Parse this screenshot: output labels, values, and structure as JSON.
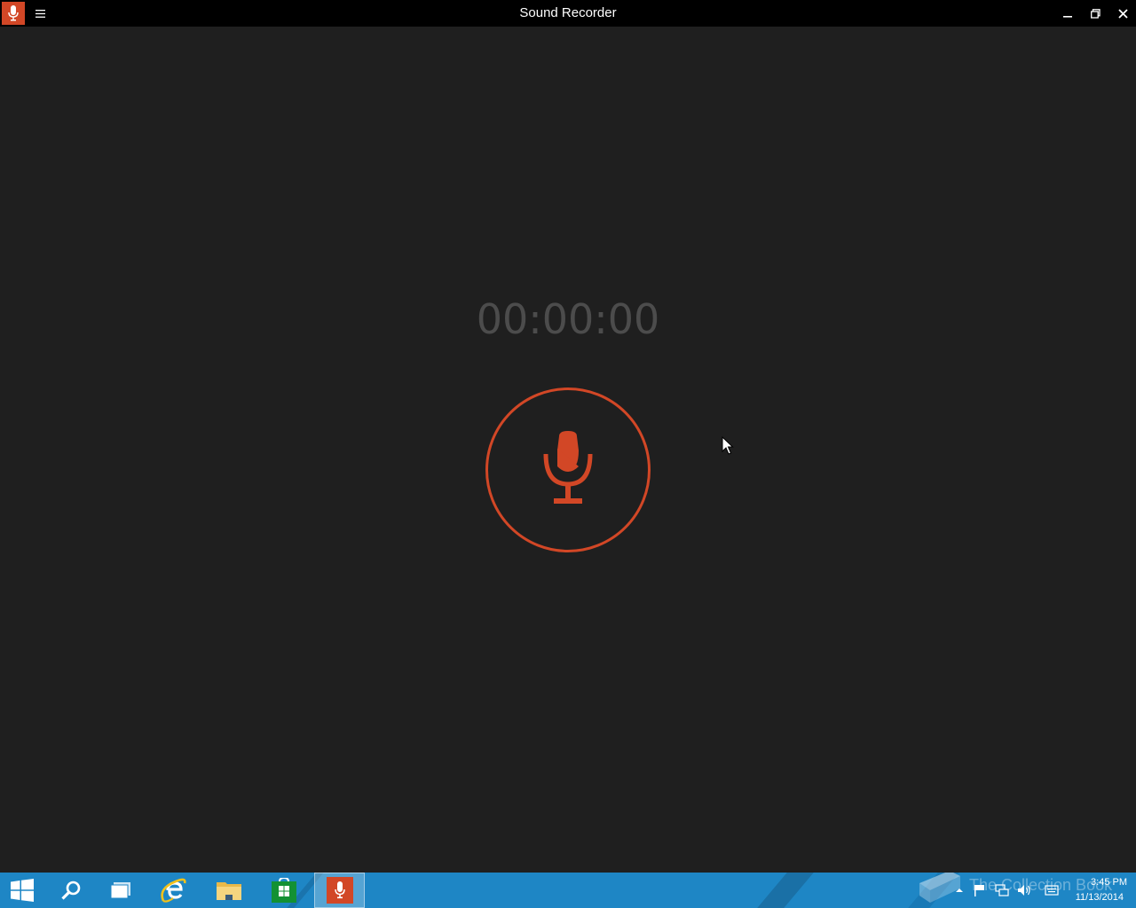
{
  "window": {
    "title": "Sound Recorder",
    "accent": "#d24726"
  },
  "titlebar": {
    "app_icon": "microphone-icon",
    "menu_icon": "hamburger-icon",
    "minimize_icon": "minimize-icon",
    "maximize_icon": "restore-icon",
    "close_icon": "close-icon"
  },
  "main": {
    "timer": "00:00:00",
    "record_icon": "microphone-icon"
  },
  "taskbar": {
    "color": "#1e86c5",
    "items": [
      {
        "name": "start",
        "icon": "windows-logo-icon"
      },
      {
        "name": "search",
        "icon": "search-icon"
      },
      {
        "name": "task-view",
        "icon": "task-view-icon"
      },
      {
        "name": "internet-explorer",
        "icon": "ie-icon"
      },
      {
        "name": "file-explorer",
        "icon": "folder-icon"
      },
      {
        "name": "store",
        "icon": "store-icon"
      },
      {
        "name": "sound-recorder",
        "icon": "microphone-icon",
        "active": true
      }
    ],
    "tray": {
      "icons": [
        "chevron-up-icon",
        "flag-icon",
        "network-icon",
        "volume-icon",
        "keyboard-icon"
      ],
      "watermark": "The Collection Book",
      "time": "3:45 PM",
      "date": "11/13/2014"
    }
  }
}
